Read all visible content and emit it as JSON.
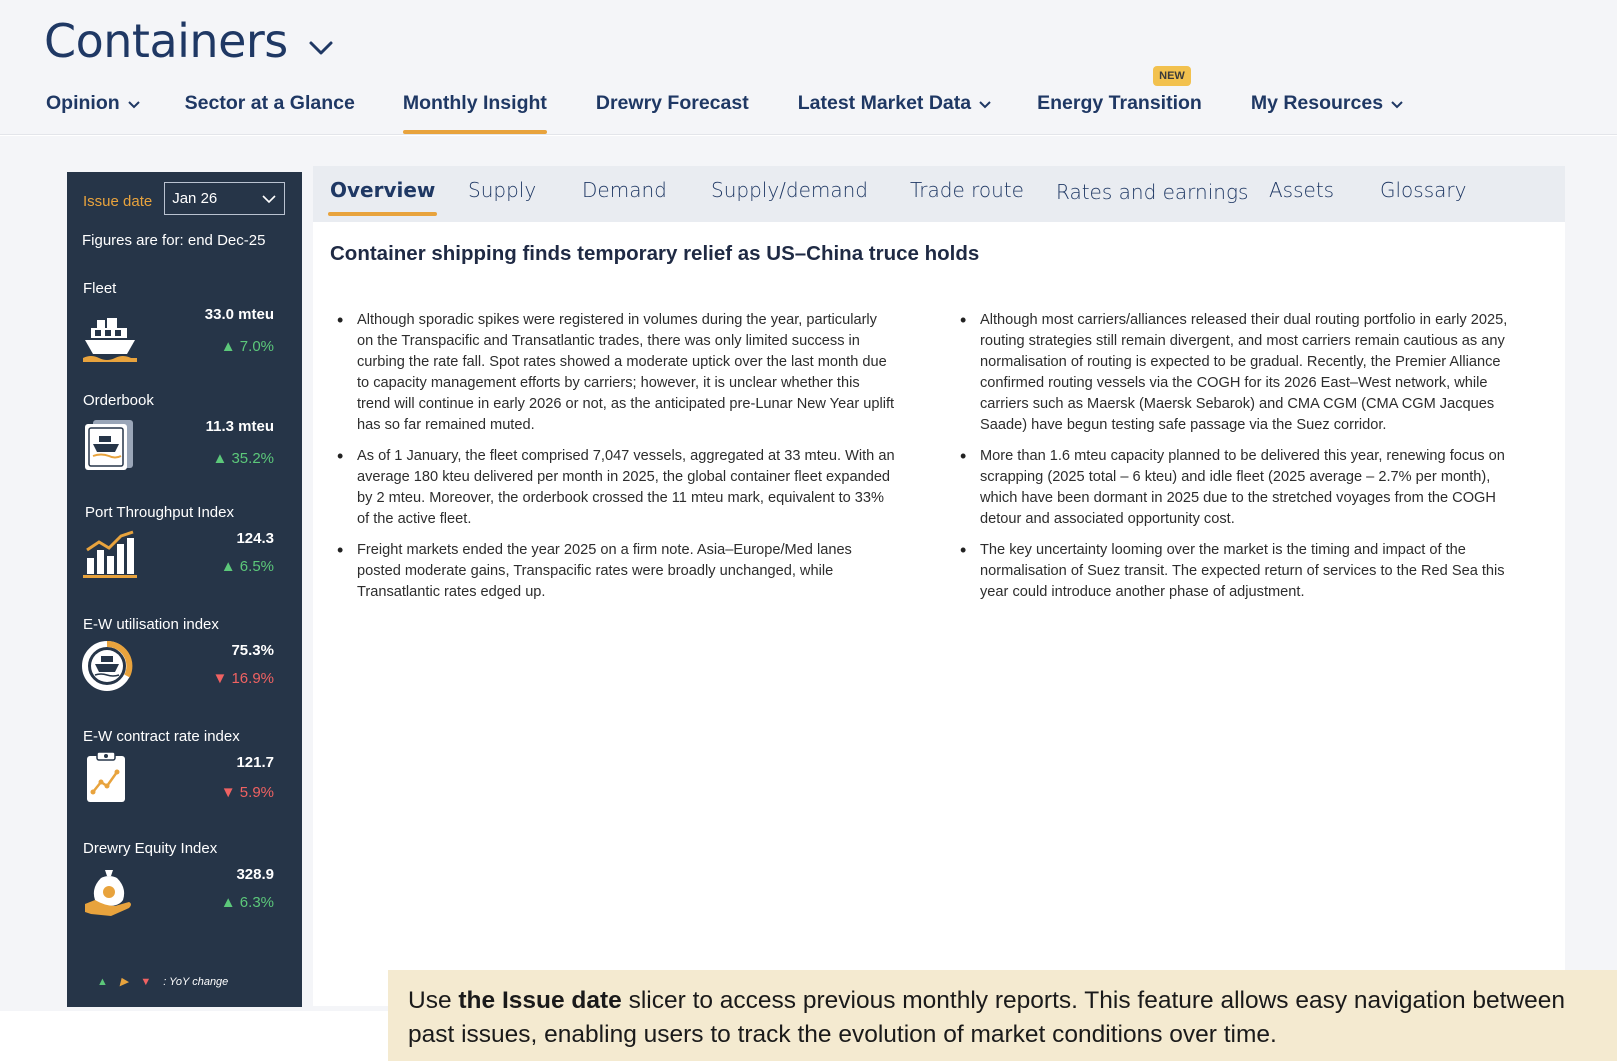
{
  "header": {
    "title": "Containers",
    "nav": [
      {
        "label": "Opinion",
        "has_dropdown": true,
        "active": false
      },
      {
        "label": "Sector at a Glance",
        "has_dropdown": false,
        "active": false
      },
      {
        "label": "Monthly Insight",
        "has_dropdown": false,
        "active": true
      },
      {
        "label": "Drewry Forecast",
        "has_dropdown": false,
        "active": false
      },
      {
        "label": "Latest Market Data",
        "has_dropdown": true,
        "active": false
      },
      {
        "label": "Energy Transition",
        "has_dropdown": false,
        "active": false,
        "badge": "NEW"
      },
      {
        "label": "My Resources",
        "has_dropdown": true,
        "active": false
      }
    ]
  },
  "sidebar": {
    "issue_label": "Issue date",
    "issue_value": "Jan 26",
    "figures_note": "Figures are for: end Dec-25",
    "metrics": [
      {
        "label": "Fleet",
        "value": "33.0 mteu",
        "change": "▲ 7.0%",
        "direction": "up",
        "icon": "ship-icon"
      },
      {
        "label": "Orderbook",
        "value": "11.3 mteu",
        "change": "▲ 35.2%",
        "direction": "up",
        "icon": "orderbook-icon"
      },
      {
        "label": "Port Throughput Index",
        "value": "124.3",
        "change": "▲ 6.5%",
        "direction": "up",
        "icon": "bar-chart-icon"
      },
      {
        "label": "E-W utilisation index",
        "value": "75.3%",
        "change": "▼ 16.9%",
        "direction": "down",
        "icon": "gauge-ship-icon"
      },
      {
        "label": "E-W contract rate index",
        "value": "121.7",
        "change": "▼ 5.9%",
        "direction": "down",
        "icon": "clipboard-chart-icon"
      },
      {
        "label": "Drewry Equity Index",
        "value": "328.9",
        "change": "▲ 6.3%",
        "direction": "up",
        "icon": "money-bag-icon"
      }
    ],
    "legend_text": ": YoY change"
  },
  "tabs": [
    {
      "label": "Overview",
      "active": true
    },
    {
      "label": "Supply",
      "active": false
    },
    {
      "label": "Demand",
      "active": false
    },
    {
      "label": "Supply/demand",
      "active": false
    },
    {
      "label": "Trade route",
      "active": false
    },
    {
      "label": "Rates and earnings",
      "active": false
    },
    {
      "label": "Assets",
      "active": false
    },
    {
      "label": "Glossary",
      "active": false
    }
  ],
  "article": {
    "headline": "Container shipping finds temporary relief as US–China truce holds",
    "left_bullets": [
      "Although sporadic spikes were registered in volumes during the year, particularly on the Transpacific and Transatlantic trades, there was only limited success in curbing the rate fall. Spot rates showed a moderate uptick over the last month due to capacity management efforts by carriers; however, it is unclear whether this trend will continue in early 2026 or not, as the anticipated pre-Lunar New Year uplift has so far remained muted.",
      "As of 1 January, the fleet comprised 7,047 vessels, aggregated at 33 mteu. With an average 180 kteu delivered per month in 2025, the global container fleet expanded by 2 mteu. Moreover, the orderbook crossed the 11 mteu mark, equivalent to 33% of the active fleet.",
      "Freight markets ended the year 2025 on a firm note. Asia–Europe/Med lanes posted moderate gains, Transpacific rates were broadly unchanged, while Transatlantic rates edged up."
    ],
    "right_bullets": [
      "Although most carriers/alliances released their dual routing portfolio in early 2025, routing strategies still remain divergent, and most carriers remain cautious as any normalisation of routing is expected to be gradual. Recently, the Premier Alliance confirmed routing vessels via the COGH for its 2026 East–West network, while carriers such as Maersk (Maersk Sebarok) and CMA CGM (CMA CGM Jacques Saade) have begun testing safe passage via the Suez corridor.",
      "More than 1.6 mteu capacity planned to be delivered this year, renewing focus on scrapping (2025 total – 6 kteu) and idle fleet (2025 average – 2.7% per month), which have been dormant in 2025 due to the stretched voyages from the COGH detour and associated opportunity cost.",
      "The key uncertainty looming over the market is the timing and impact of the normalisation of Suez transit. The expected return of services to the Red Sea this year could introduce another phase of adjustment."
    ]
  },
  "callout": {
    "prefix": "Use ",
    "bold": "the Issue date",
    "suffix": " slicer to access previous monthly reports. This feature allows easy navigation between past issues, enabling users to track the evolution of market conditions over time."
  },
  "colors": {
    "accent": "#e8a33d",
    "sidebar_bg": "#263548",
    "up": "#5cc87a",
    "down": "#f06262",
    "neutral": "#e8a33d",
    "brand": "#1f3864"
  }
}
